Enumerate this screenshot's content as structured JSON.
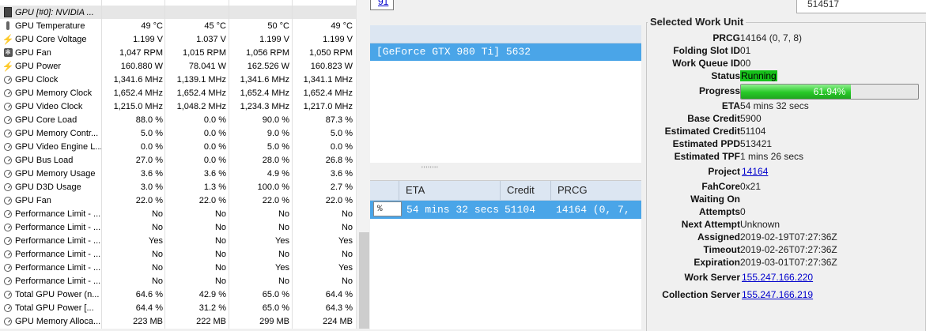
{
  "sensors": {
    "group_label": "GPU [#0]: NVIDIA ...",
    "rows": [
      {
        "icon": "thermometer-icon",
        "name": "GPU Temperature",
        "values": [
          "49 °C",
          "45 °C",
          "50 °C",
          "49 °C"
        ]
      },
      {
        "icon": "voltage-bolt-icon",
        "name": "GPU Core Voltage",
        "values": [
          "1.199 V",
          "1.037 V",
          "1.199 V",
          "1.199 V"
        ]
      },
      {
        "icon": "fan-icon",
        "name": "GPU Fan",
        "values": [
          "1,047 RPM",
          "1,015 RPM",
          "1,056 RPM",
          "1,050 RPM"
        ]
      },
      {
        "icon": "power-bolt-icon",
        "name": "GPU Power",
        "values": [
          "160.880 W",
          "78.041 W",
          "162.526 W",
          "160.823 W"
        ]
      },
      {
        "icon": "gauge-icon",
        "name": "GPU Clock",
        "values": [
          "1,341.6 MHz",
          "1,139.1 MHz",
          "1,341.6 MHz",
          "1,341.1 MHz"
        ]
      },
      {
        "icon": "gauge-icon",
        "name": "GPU Memory Clock",
        "values": [
          "1,652.4 MHz",
          "1,652.4 MHz",
          "1,652.4 MHz",
          "1,652.4 MHz"
        ]
      },
      {
        "icon": "gauge-icon",
        "name": "GPU Video Clock",
        "values": [
          "1,215.0 MHz",
          "1,048.2 MHz",
          "1,234.3 MHz",
          "1,217.0 MHz"
        ]
      },
      {
        "icon": "gauge-icon",
        "name": "GPU Core Load",
        "values": [
          "88.0 %",
          "0.0 %",
          "90.0 %",
          "87.3 %"
        ]
      },
      {
        "icon": "gauge-icon",
        "name": "GPU Memory Contr...",
        "values": [
          "5.0 %",
          "0.0 %",
          "9.0 %",
          "5.0 %"
        ]
      },
      {
        "icon": "gauge-icon",
        "name": "GPU Video Engine L...",
        "values": [
          "0.0 %",
          "0.0 %",
          "5.0 %",
          "0.0 %"
        ]
      },
      {
        "icon": "gauge-icon",
        "name": "GPU Bus Load",
        "values": [
          "27.0 %",
          "0.0 %",
          "28.0 %",
          "26.8 %"
        ]
      },
      {
        "icon": "gauge-icon",
        "name": "GPU Memory Usage",
        "values": [
          "3.6 %",
          "3.6 %",
          "4.9 %",
          "3.6 %"
        ]
      },
      {
        "icon": "gauge-icon",
        "name": "GPU D3D Usage",
        "values": [
          "3.0 %",
          "1.3 %",
          "100.0 %",
          "2.7 %"
        ]
      },
      {
        "icon": "gauge-icon",
        "name": "GPU Fan",
        "values": [
          "22.0 %",
          "22.0 %",
          "22.0 %",
          "22.0 %"
        ]
      },
      {
        "icon": "gauge-icon",
        "name": "Performance Limit - ...",
        "values": [
          "No",
          "No",
          "No",
          "No"
        ]
      },
      {
        "icon": "gauge-icon",
        "name": "Performance Limit - ...",
        "values": [
          "No",
          "No",
          "No",
          "No"
        ]
      },
      {
        "icon": "gauge-icon",
        "name": "Performance Limit - ...",
        "values": [
          "Yes",
          "No",
          "Yes",
          "Yes"
        ]
      },
      {
        "icon": "gauge-icon",
        "name": "Performance Limit - ...",
        "values": [
          "No",
          "No",
          "No",
          "No"
        ]
      },
      {
        "icon": "gauge-icon",
        "name": "Performance Limit - ...",
        "values": [
          "No",
          "No",
          "Yes",
          "Yes"
        ]
      },
      {
        "icon": "gauge-icon",
        "name": "Performance Limit - ...",
        "values": [
          "No",
          "No",
          "No",
          "No"
        ]
      },
      {
        "icon": "gauge-icon",
        "name": "Total GPU Power (n...",
        "values": [
          "64.6 %",
          "42.9 %",
          "65.0 %",
          "64.4 %"
        ]
      },
      {
        "icon": "gauge-icon",
        "name": "Total GPU Power [...",
        "values": [
          "64.4 %",
          "31.2 %",
          "65.0 %",
          "64.3 %"
        ]
      },
      {
        "icon": "gauge-icon",
        "name": "GPU Memory Alloca...",
        "values": [
          "223 MB",
          "222 MB",
          "299 MB",
          "224 MB"
        ]
      }
    ]
  },
  "fah": {
    "top_link": "91",
    "slot_row_text": "[GeForce GTX 980 Ti] 5632",
    "queue_headers": {
      "eta": "ETA",
      "credit": "Credit",
      "prcg": "PRCG"
    },
    "queue_row": {
      "pct": "%",
      "eta": "54 mins 32 secs",
      "credit": "51104",
      "prcg": "14164 (0, 7,"
    },
    "top_right_value": "514517"
  },
  "work_unit": {
    "title": "Selected Work Unit",
    "prcg_label": "PRCG",
    "prcg": "14164 (0, 7, 8)",
    "slot_label": "Folding Slot ID",
    "slot": "01",
    "queue_label": "Work Queue ID",
    "queue": "00",
    "status_label": "Status",
    "status": "Running",
    "progress_label": "Progress",
    "progress_text": "61.94%",
    "progress_fraction": 0.6194,
    "eta_label": "ETA",
    "eta": "54 mins 32 secs",
    "base_credit_label": "Base Credit",
    "base_credit": "5900",
    "est_credit_label": "Estimated Credit",
    "est_credit": "51104",
    "est_ppd_label": "Estimated PPD",
    "est_ppd": "513421",
    "est_tpf_label": "Estimated TPF",
    "est_tpf": "1 mins 26 secs",
    "project_label": "Project",
    "project": "14164",
    "fahcore_label": "FahCore",
    "fahcore": "0x21",
    "waiting_label": "Waiting On",
    "waiting": "",
    "attempts_label": "Attempts",
    "attempts": "0",
    "next_attempt_label": "Next Attempt",
    "next_attempt": "Unknown",
    "assigned_label": "Assigned",
    "assigned": "2019-02-19T07:27:36Z",
    "timeout_label": "Timeout",
    "timeout": "2019-02-26T07:27:36Z",
    "expiration_label": "Expiration",
    "expiration": "2019-03-01T07:27:36Z",
    "work_server_label": "Work Server",
    "work_server": "155.247.166.220",
    "collection_server_label": "Collection Server",
    "collection_server": "155.247.166.219"
  }
}
